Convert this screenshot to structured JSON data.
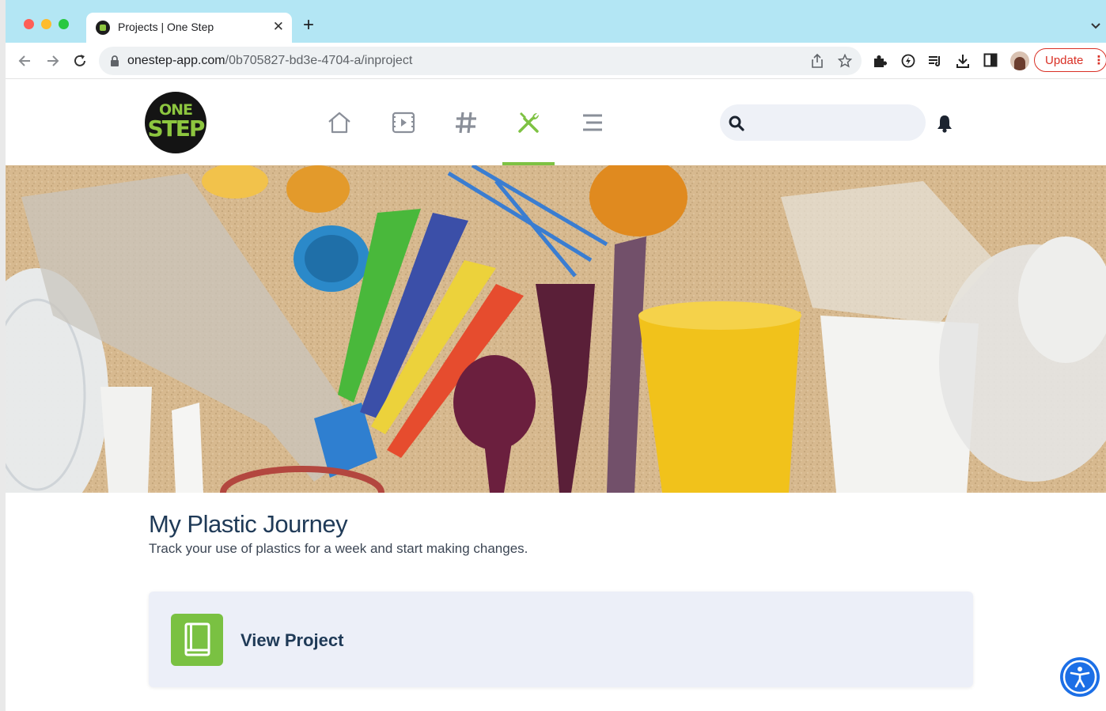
{
  "browser": {
    "tab_title": "Projects | One Step",
    "tab_close": "✕",
    "new_tab": "+",
    "url_host": "onestep-app.com",
    "url_path": "/0b705827-bd3e-4704-a/inproject",
    "update_label": "Update"
  },
  "site": {
    "logo_line1": "ONE",
    "logo_line2": "STEP",
    "nav": [
      {
        "name": "home",
        "active": false
      },
      {
        "name": "video",
        "active": false
      },
      {
        "name": "hashtag",
        "active": false
      },
      {
        "name": "projects",
        "active": true
      },
      {
        "name": "menu",
        "active": false
      }
    ],
    "search_placeholder": ""
  },
  "project": {
    "title": "My Plastic Journey",
    "description": "Track your use of plastics for a week and start making changes.",
    "view_label": "View Project"
  },
  "colors": {
    "brand_green": "#7ec243",
    "title_blue": "#1f3a57",
    "accessibility_blue": "#1c6fe6"
  }
}
